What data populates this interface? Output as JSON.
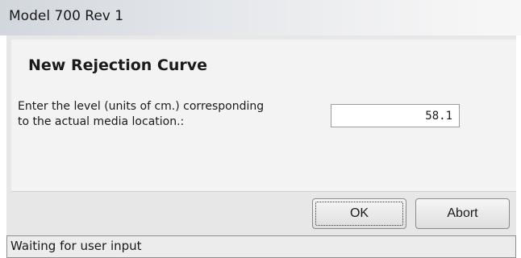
{
  "window": {
    "title": "Model 700 Rev 1"
  },
  "dialog": {
    "heading": "New Rejection Curve",
    "prompt_line1": "Enter the level (units of cm.) corresponding",
    "prompt_line2": "to the actual media location.:",
    "level_value": "58.1"
  },
  "buttons": {
    "ok_label": "OK",
    "abort_label": "Abort"
  },
  "status": {
    "text": "Waiting for user input"
  }
}
